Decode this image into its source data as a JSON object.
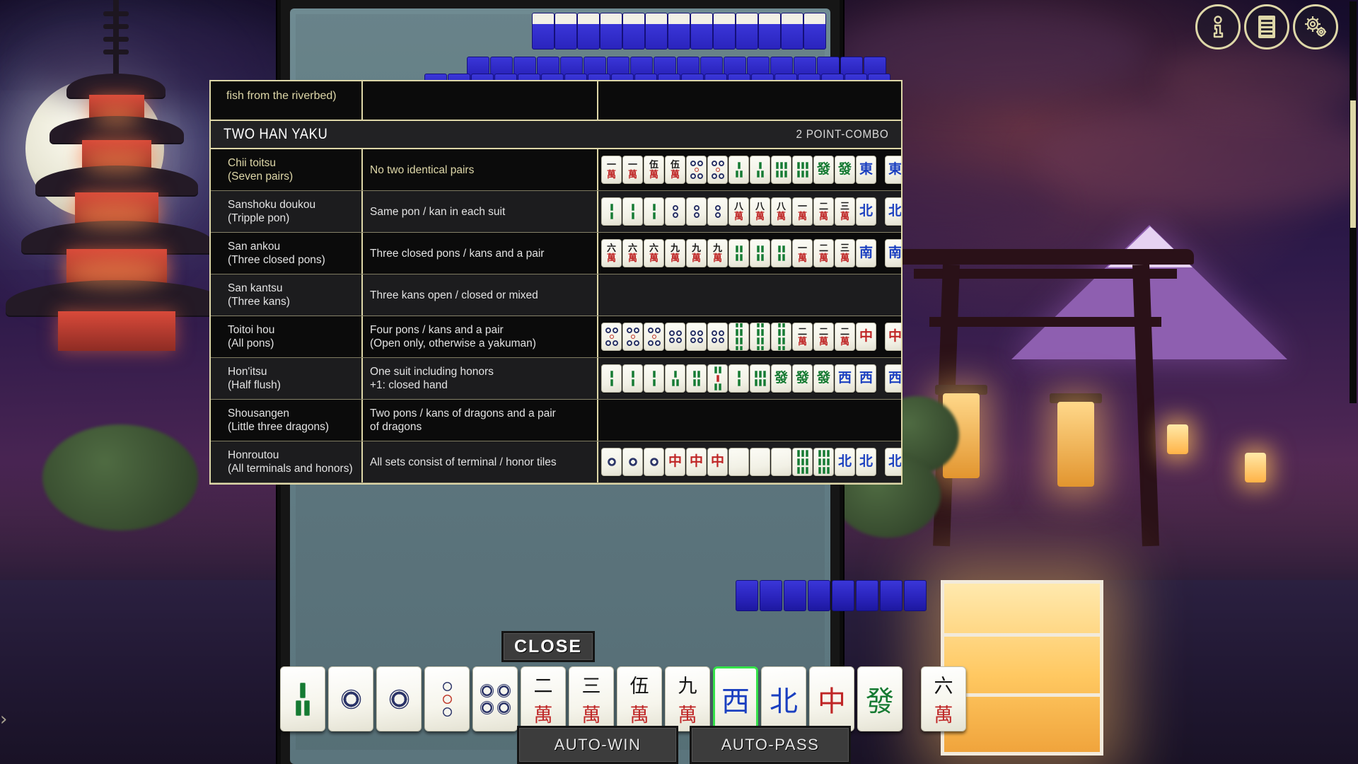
{
  "hud": {
    "info_icon": "info-icon",
    "log_icon": "list-log-icon",
    "settings_icon": "gear-icon",
    "sidebar_arrow": "›"
  },
  "dialog": {
    "partial_row_text": "fish from the riverbed)",
    "section": {
      "title": "TWO HAN YAKU",
      "points": "2 POINT-COMBO"
    },
    "scrollbar": "vertical-scrollbar",
    "rows": [
      {
        "name": "Chii toitsu",
        "subname": "(Seven pairs)",
        "desc": "No two identical pairs",
        "desc2": "",
        "gold": true,
        "tiles": [
          "m1",
          "m1",
          "m5",
          "m5",
          "p5",
          "p5",
          "s3",
          "s3",
          "s6",
          "s6",
          "hatsu",
          "hatsu",
          "east",
          "|",
          "east"
        ]
      },
      {
        "name": "Sanshoku doukou",
        "subname": "(Tripple pon)",
        "desc": "Same pon / kan in each suit",
        "desc2": "",
        "gold": false,
        "tiles": [
          "s2",
          "s2",
          "s2",
          "p2",
          "p2",
          "p2",
          "m8",
          "m8",
          "m8",
          "m1",
          "m2",
          "m3",
          "north",
          "|",
          "north"
        ]
      },
      {
        "name": "San ankou",
        "subname": "(Three closed pons)",
        "desc": "Three closed pons / kans and a pair",
        "desc2": "",
        "gold": false,
        "tiles": [
          "m6",
          "m6",
          "m6",
          "m9",
          "m9",
          "m9",
          "s4",
          "s4",
          "s4",
          "m1",
          "m2",
          "m3",
          "south",
          "|",
          "south"
        ]
      },
      {
        "name": "San kantsu",
        "subname": "(Three kans)",
        "desc": "Three kans open / closed or mixed",
        "desc2": "",
        "gold": false,
        "tiles": []
      },
      {
        "name": "Toitoi hou",
        "subname": "(All pons)",
        "desc": "Four pons / kans and a pair",
        "desc2": "(Open only, otherwise a yakuman)",
        "gold": false,
        "tiles": [
          "p5",
          "p5",
          "p5",
          "p4",
          "p4",
          "p4",
          "s8",
          "s8",
          "s8",
          "m2",
          "m2",
          "m2",
          "chun",
          "|",
          "chun"
        ]
      },
      {
        "name": "Hon'itsu",
        "subname": "(Half flush)",
        "desc": "One suit including honors",
        "desc2": "+1: closed hand",
        "gold": false,
        "tiles": [
          "s2",
          "s2",
          "s2",
          "s3",
          "s4",
          "s5",
          "s2",
          "s6",
          "hatsu",
          "hatsu",
          "hatsu",
          "west",
          "west",
          "|",
          "west"
        ]
      },
      {
        "name": "Shousangen",
        "subname": "(Little three dragons)",
        "desc": "Two pons / kans of dragons and a pair",
        "desc2": "of dragons",
        "gold": false,
        "tiles": []
      },
      {
        "name": "Honroutou",
        "subname": "(All terminals and honors)",
        "desc": "All sets consist of terminal / honor tiles",
        "desc2": "",
        "gold": false,
        "tiles": [
          "p1",
          "p1",
          "p1",
          "chun",
          "chun",
          "chun",
          "blank",
          "blank",
          "blank",
          "s9",
          "s9",
          "north",
          "north",
          "|",
          "north"
        ]
      }
    ]
  },
  "buttons": {
    "close": "CLOSE",
    "auto_win": "AUTO-WIN",
    "auto_pass": "AUTO-PASS"
  },
  "player_hand": {
    "tiles": [
      "s3",
      "p1",
      "p1",
      "p3",
      "p4",
      "m2",
      "m3",
      "m5",
      "m9",
      "west",
      "north",
      "chun",
      "hatsu"
    ],
    "drawn_tile": "m6",
    "selected_index": 9
  }
}
